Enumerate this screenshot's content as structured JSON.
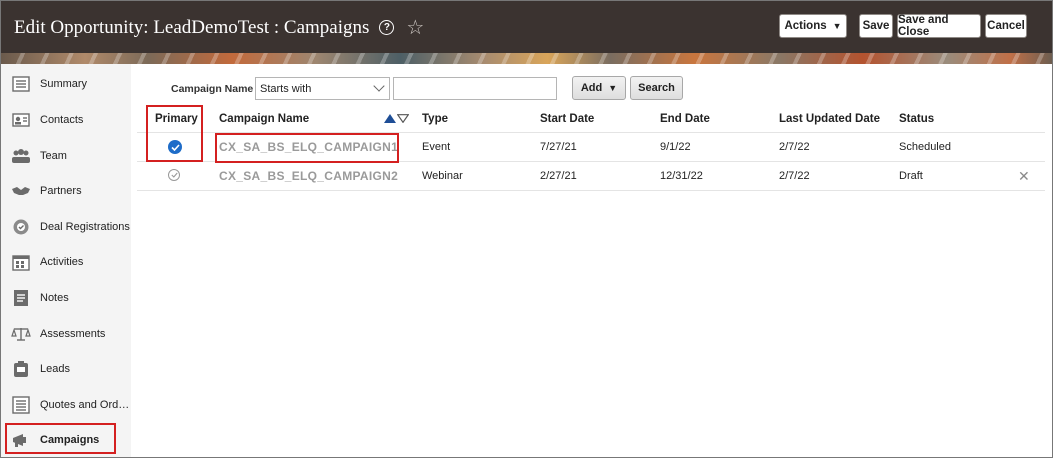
{
  "header": {
    "title": "Edit Opportunity: LeadDemoTest : Campaigns",
    "help_icon": "?",
    "actions_label": "Actions",
    "save_label": "Save",
    "save_close_label": "Save and Close",
    "cancel_label": "Cancel"
  },
  "sidebar": {
    "items": [
      {
        "label": "Summary",
        "icon": "summary-icon"
      },
      {
        "label": "Contacts",
        "icon": "contacts-icon"
      },
      {
        "label": "Team",
        "icon": "team-icon"
      },
      {
        "label": "Partners",
        "icon": "partners-icon"
      },
      {
        "label": "Deal Registrations",
        "icon": "deal-registrations-icon"
      },
      {
        "label": "Activities",
        "icon": "activities-icon"
      },
      {
        "label": "Notes",
        "icon": "notes-icon"
      },
      {
        "label": "Assessments",
        "icon": "assessments-icon"
      },
      {
        "label": "Leads",
        "icon": "leads-icon"
      },
      {
        "label": "Quotes and Ord…",
        "icon": "quotes-icon"
      },
      {
        "label": "Campaigns",
        "icon": "campaigns-icon",
        "active": true
      }
    ]
  },
  "search": {
    "label": "Campaign Name",
    "operator": "Starts with",
    "value": "",
    "add_label": "Add",
    "search_label": "Search"
  },
  "table": {
    "columns": [
      "Primary",
      "Campaign Name",
      "Type",
      "Start Date",
      "End Date",
      "Last Updated Date",
      "Status"
    ],
    "rows": [
      {
        "primary": true,
        "name": "CX_SA_BS_ELQ_CAMPAIGN1",
        "type": "Event",
        "start": "7/27/21",
        "end": "9/1/22",
        "updated": "2/7/22",
        "status": "Scheduled"
      },
      {
        "primary": false,
        "name": "CX_SA_BS_ELQ_CAMPAIGN2",
        "type": "Webinar",
        "start": "2/27/21",
        "end": "12/31/22",
        "updated": "2/7/22",
        "status": "Draft"
      }
    ]
  },
  "colors": {
    "header_bg": "#3b3330",
    "primary_check": "#1e6cc8",
    "highlight": "#d42020"
  }
}
